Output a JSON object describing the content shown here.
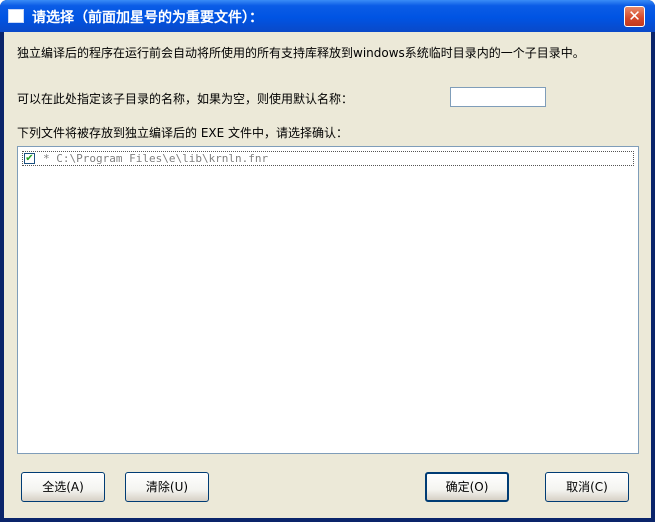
{
  "window": {
    "title": "请选择（前面加星号的为重要文件）：",
    "close_glyph": "✕",
    "icon": "window-icon"
  },
  "description": "独立编译后的程序在运行前会自动将所使用的所有支持库释放到windows系统临时目录内的一个子目录中。",
  "subdir": {
    "label": "可以在此处指定该子目录的名称，如果为空，则使用默认名称：",
    "value": "",
    "placeholder": ""
  },
  "list": {
    "label": "下列文件将被存放到独立编译后的 EXE 文件中，请选择确认：",
    "items": [
      {
        "checked": true,
        "text": "* C:\\Program Files\\e\\lib\\krnln.fnr"
      }
    ]
  },
  "buttons": {
    "select_all": "全选(A)",
    "clear": "清除(U)",
    "ok": "确定(O)",
    "cancel": "取消(C)"
  },
  "colors": {
    "titlebar": "#0054e3",
    "client_bg": "#ece9d8",
    "close_button": "#d4472a",
    "item_text": "#808080"
  }
}
